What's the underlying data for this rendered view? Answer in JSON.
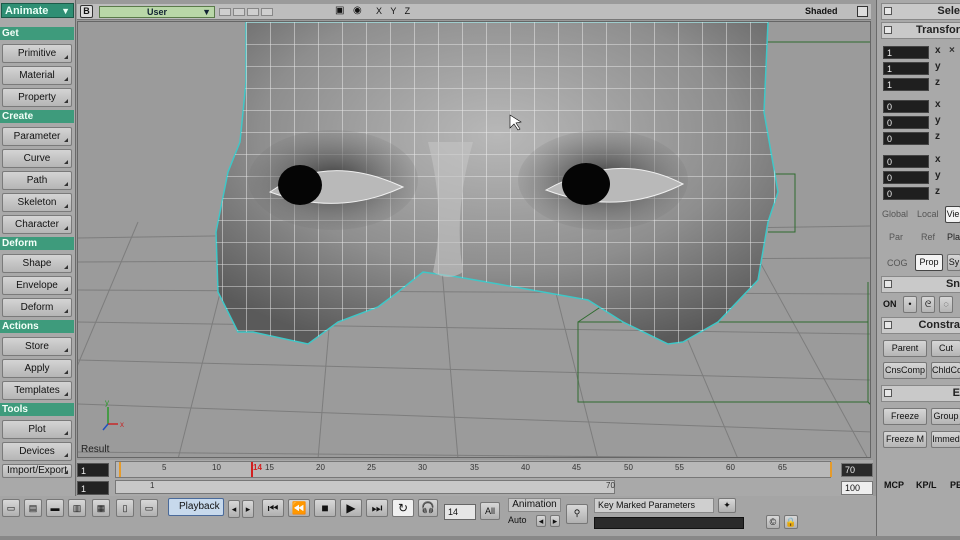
{
  "left_panel": {
    "mode": "Animate",
    "sections": [
      {
        "title": "Get",
        "buttons": [
          "Primitive",
          "Material",
          "Property"
        ]
      },
      {
        "title": "Create",
        "buttons": [
          "Parameter",
          "Curve",
          "Path",
          "Skeleton",
          "Character"
        ]
      },
      {
        "title": "Deform",
        "buttons": [
          "Shape",
          "Envelope",
          "Deform"
        ]
      },
      {
        "title": "Actions",
        "buttons": [
          "Store",
          "Apply",
          "Templates"
        ]
      },
      {
        "title": "Tools",
        "buttons": [
          "Plot",
          "Devices",
          "Import/Export"
        ]
      }
    ]
  },
  "viewport": {
    "camera_button": "B",
    "view_mode": "User",
    "axes": "X Y Z",
    "display_mode": "Shaded",
    "result_label": "Result",
    "axis_gizmo": {
      "y": "y",
      "x": "x"
    }
  },
  "timeline": {
    "start_field": "1",
    "start_field_2": "1",
    "end_field": "70",
    "end_field_2": "100",
    "current_frame_label": "14",
    "ruler_ticks": [
      "5",
      "10",
      "15",
      "20",
      "25",
      "30",
      "35",
      "40",
      "45",
      "50",
      "55",
      "60",
      "65"
    ],
    "range_start": "1",
    "range_end": "70"
  },
  "bottom_toolbar": {
    "playback_label": "Playback",
    "frame": "14",
    "all_label": "All",
    "animation_label": "Animation",
    "auto_label": "Auto",
    "key_marked_label": "Key Marked Parameters"
  },
  "right_panel": {
    "select_header": "Sele",
    "transform_header": "Transfor",
    "scale": [
      "1",
      "1",
      "1"
    ],
    "rotate": [
      "0",
      "0",
      "0"
    ],
    "translate": [
      "0",
      "0",
      "0"
    ],
    "axes": [
      "x",
      "y",
      "z"
    ],
    "global_label": "Global",
    "local_label": "Local",
    "view_label": "Vie",
    "par_label": "Par",
    "ref_label": "Ref",
    "pla_label": "Pla",
    "cog_label": "COG",
    "prop_label": "Prop",
    "sym_label": "Sy",
    "snap_header": "Sn",
    "snap_on": "ON",
    "constrain_header": "Constra",
    "parent_btn": "Parent",
    "cut_btn": "Cut",
    "cnscomp_btn": "CnsComp",
    "chldcomp_btn": "ChldCo",
    "edit_header": "E",
    "freeze_btn": "Freeze",
    "group_btn": "Group",
    "freezem_btn": "Freeze M",
    "immed_btn": "Immed",
    "tabs": [
      "MCP",
      "KP/L",
      "PE"
    ]
  },
  "colors": {
    "section_header": "#3e9b7c",
    "view_button": "#b9d7a8",
    "selection_outline": "#3fc7c7",
    "grid_green": "#2f6b2f"
  }
}
